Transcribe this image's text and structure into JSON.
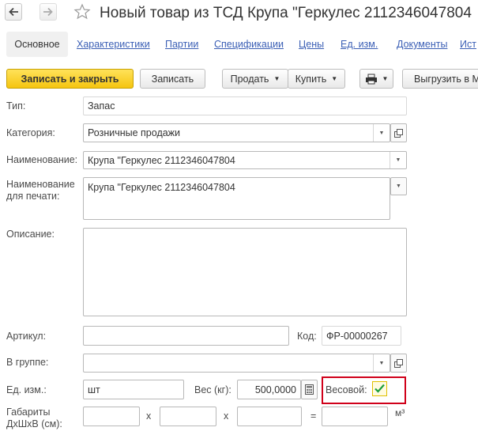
{
  "window": {
    "title": "Новый товар из ТСД Крупа \"Геркулес 2112346047804"
  },
  "tabs": [
    {
      "label": "Основное"
    },
    {
      "label": "Характеристики"
    },
    {
      "label": "Партии"
    },
    {
      "label": "Спецификации"
    },
    {
      "label": "Цены"
    },
    {
      "label": "Ед. изм."
    },
    {
      "label": "Документы"
    },
    {
      "label": "Ист"
    }
  ],
  "toolbar": {
    "save_close": "Записать и закрыть",
    "save": "Записать",
    "sell": "Продать",
    "buy": "Купить",
    "unload": "Выгрузить в М"
  },
  "form": {
    "type_label": "Тип:",
    "type_value": "Запас",
    "category_label": "Категория:",
    "category_value": "Розничные продажи",
    "name_label": "Наименование:",
    "name_value": "Крупа \"Геркулес 2112346047804",
    "print_name_label": "Наименование для печати:",
    "print_name_value": "Крупа \"Геркулес 2112346047804",
    "description_label": "Описание:",
    "description_value": "",
    "article_label": "Артикул:",
    "article_value": "",
    "code_label": "Код:",
    "code_value": "ФР-00000267",
    "group_label": "В группе:",
    "group_value": "",
    "unit_label": "Ед. изм.:",
    "unit_value": "шт",
    "weight_label": "Вес (кг):",
    "weight_value": "500,0000",
    "weighted_label": "Весовой:",
    "weighted_checked": true,
    "dims_label": "Габариты ДхШхВ (см):",
    "dims_x1": "х",
    "dims_x2": "х",
    "dims_eq": "=",
    "dims_unit": "м³"
  },
  "colors": {
    "primary_button": "#f5c510",
    "link": "#3b5fb5",
    "highlight": "#d0001a",
    "checkmark": "#1e9e3a"
  },
  "icons": [
    "back-arrow-icon",
    "forward-arrow-icon",
    "star-icon",
    "printer-icon",
    "calculator-icon",
    "open-form-icon",
    "chevron-down-icon",
    "checkmark-icon"
  ]
}
